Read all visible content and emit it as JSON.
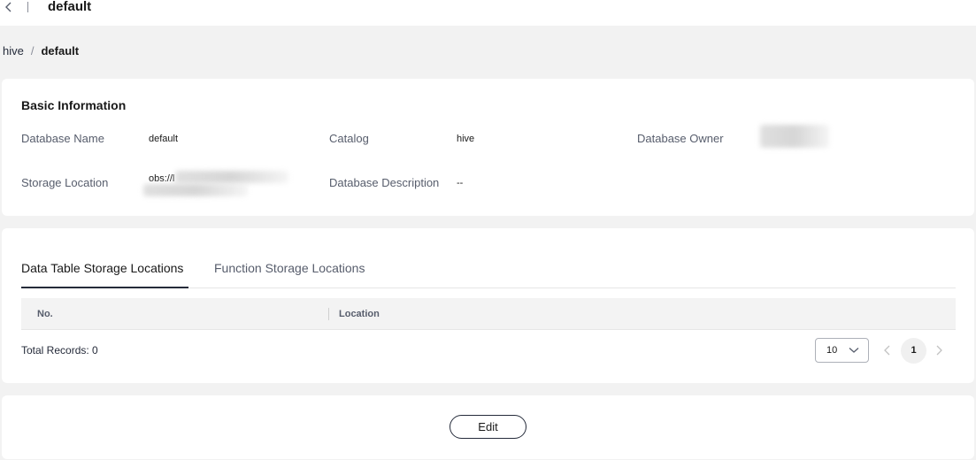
{
  "header": {
    "title": "default",
    "back_icon": "chevron-left-icon"
  },
  "breadcrumb": {
    "parent": "hive",
    "separator": "/",
    "current": "default"
  },
  "basic_info": {
    "title": "Basic Information",
    "fields": {
      "database_name": {
        "label": "Database Name",
        "value": "default"
      },
      "catalog": {
        "label": "Catalog",
        "value": "hive"
      },
      "database_owner": {
        "label": "Database Owner",
        "value": ""
      },
      "storage_location": {
        "label": "Storage Location",
        "value": "obs://l"
      },
      "database_description": {
        "label": "Database Description",
        "value": "--"
      }
    }
  },
  "locations": {
    "tabs": [
      {
        "label": "Data Table Storage Locations",
        "active": true
      },
      {
        "label": "Function Storage Locations",
        "active": false
      }
    ],
    "table": {
      "columns": [
        "No.",
        "Location"
      ],
      "rows": []
    },
    "total_records_label": "Total Records: 0",
    "pagination": {
      "page_size": "10",
      "current_page": "1"
    }
  },
  "actions": {
    "edit_label": "Edit"
  },
  "colors": {
    "background": "#f2f2f2",
    "card": "#ffffff",
    "text_primary": "#191919",
    "text_secondary": "#575d6c",
    "accent_underline": "#252b3a"
  }
}
